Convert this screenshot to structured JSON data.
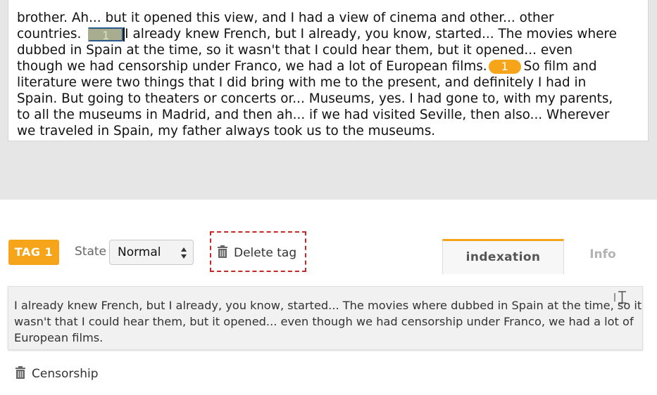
{
  "transcript": {
    "lines": [
      "",
      "brother. Ah... but it opened this view, and I had a view of cinema and other... other",
      "dubbed in Spain at the time, so it wasn't that I could hear them, but it opened... even",
      "literature were two things that I did bring with me to the present, and definitely I had in",
      "Spain. But going to theaters or concerts or... Museums, yes. I had gone to, with my parents,",
      "to all the museums in Madrid, and then ah... if we had visited Seville, then also... Wherever",
      "we traveled in Spain, my father always took us to the museums."
    ],
    "line_with_start_marker": {
      "before": "countries.",
      "after": "I already knew French, but I already, you know, started... The movies where"
    },
    "line_with_end_marker": {
      "before": "though we had censorship under Franco, we had a lot of European films.",
      "after": "So film and"
    },
    "start_marker_label": "1",
    "end_marker_label": "1"
  },
  "toolbar": {
    "tag_label": "TAG 1",
    "state_label": "State",
    "state_value": "Normal",
    "delete_label": "Delete tag"
  },
  "tabs": [
    {
      "label": "indexation",
      "active": true
    },
    {
      "label": "Info",
      "active": false
    }
  ],
  "quote": {
    "lines": [
      "I already knew French, but I already, you know, started... The movies where dubbed in Spain at the time, so it",
      "wasn't that I could hear them, but it opened... even though we had censorship under Franco, we had a lot of",
      "European films."
    ]
  },
  "indexation": {
    "items": [
      {
        "label": "Censorship"
      }
    ]
  },
  "colors": {
    "accent": "#f6a51b",
    "delete_border": "#c62828",
    "background_gray": "#e6e6e6"
  },
  "icons": {
    "delete": "trash-icon",
    "state_select": "select-arrows-icon",
    "quote_edit": "text-cursor-icon"
  }
}
